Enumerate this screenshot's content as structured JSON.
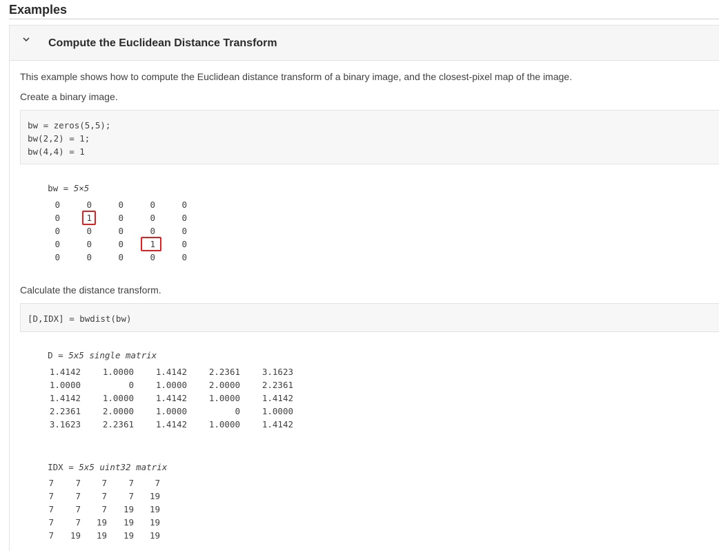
{
  "page": {
    "heading": "Examples"
  },
  "example": {
    "title": "Compute the Euclidean Distance Transform",
    "intro": "This example shows how to compute the Euclidean distance transform of a binary image, and the closest-pixel map of the image.",
    "step1": "Create a binary image.",
    "code1": [
      "bw = zeros(5,5);",
      "bw(2,2) = 1;",
      "bw(4,4) = 1"
    ],
    "bw": {
      "name": "bw =",
      "type": "5×5",
      "rows": [
        [
          "0",
          "0",
          "0",
          "0",
          "0"
        ],
        [
          "0",
          "1",
          "0",
          "0",
          "0"
        ],
        [
          "0",
          "0",
          "0",
          "0",
          "0"
        ],
        [
          "0",
          "0",
          "0",
          "1",
          "0"
        ],
        [
          "0",
          "0",
          "0",
          "0",
          "0"
        ]
      ]
    },
    "step2": "Calculate the distance transform.",
    "code2": [
      "[D,IDX] = bwdist(bw)"
    ],
    "D": {
      "name": "D =",
      "type": "5x5 single matrix",
      "rows": [
        [
          "1.4142",
          "1.0000",
          "1.4142",
          "2.2361",
          "3.1623"
        ],
        [
          "1.0000",
          "0",
          "1.0000",
          "2.0000",
          "2.2361"
        ],
        [
          "1.4142",
          "1.0000",
          "1.4142",
          "1.0000",
          "1.4142"
        ],
        [
          "2.2361",
          "2.0000",
          "1.0000",
          "0",
          "1.0000"
        ],
        [
          "3.1623",
          "2.2361",
          "1.4142",
          "1.0000",
          "1.4142"
        ]
      ]
    },
    "IDX": {
      "name": "IDX =",
      "type": "5x5 uint32 matrix",
      "rows": [
        [
          "7",
          "7",
          "7",
          "7",
          "7"
        ],
        [
          "7",
          "7",
          "7",
          "7",
          "19"
        ],
        [
          "7",
          "7",
          "7",
          "19",
          "19"
        ],
        [
          "7",
          "7",
          "19",
          "19",
          "19"
        ],
        [
          "7",
          "19",
          "19",
          "19",
          "19"
        ]
      ]
    }
  }
}
